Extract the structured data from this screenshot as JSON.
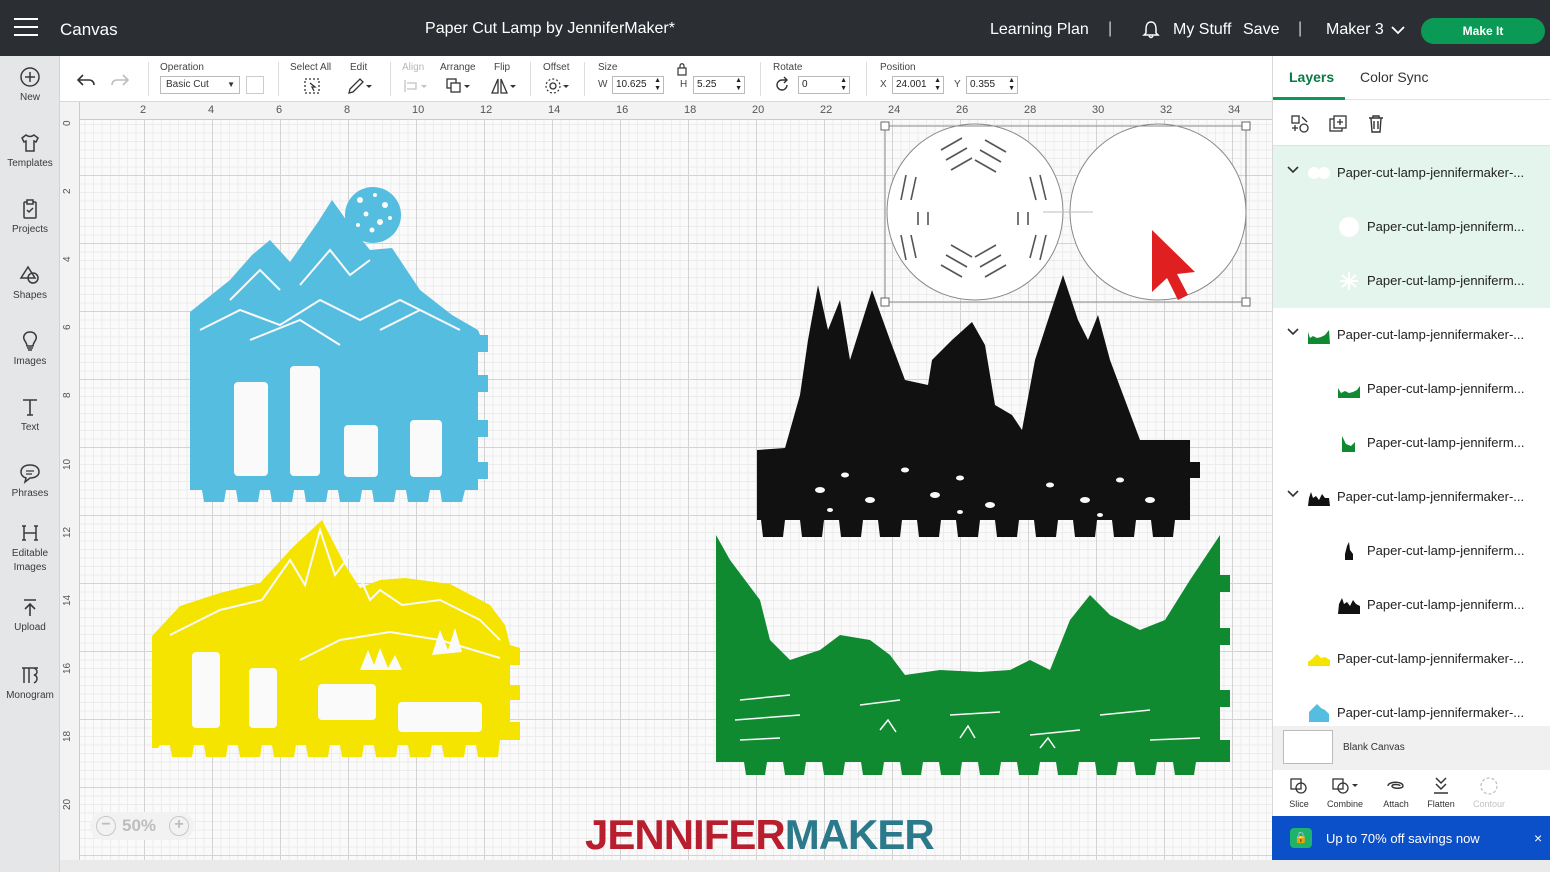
{
  "topbar": {
    "app_name": "Canvas",
    "project_title": "Paper Cut Lamp by JenniferMaker*",
    "learning_plan": "Learning Plan",
    "separator": "|",
    "my_stuff": "My Stuff",
    "save": "Save",
    "machine": "Maker 3",
    "make_it": "Make It"
  },
  "leftnav": {
    "items": [
      {
        "label": "New",
        "icon": "plus-circle-icon"
      },
      {
        "label": "Templates",
        "icon": "shirt-icon"
      },
      {
        "label": "Projects",
        "icon": "clipboard-icon"
      },
      {
        "label": "Shapes",
        "icon": "shapes-icon"
      },
      {
        "label": "Images",
        "icon": "lightbulb-icon"
      },
      {
        "label": "Text",
        "icon": "text-t-icon"
      },
      {
        "label": "Phrases",
        "icon": "speech-bubble-icon"
      },
      {
        "label": "Editable Images",
        "icon": "editable-image-icon"
      },
      {
        "label": "Upload",
        "icon": "upload-arrow-icon"
      },
      {
        "label": "Monogram",
        "icon": "monogram-icon"
      }
    ]
  },
  "toolbar": {
    "operation_label": "Operation",
    "operation_value": "Basic Cut",
    "select_all_label": "Select All",
    "edit_label": "Edit",
    "align_label": "Align",
    "arrange_label": "Arrange",
    "flip_label": "Flip",
    "offset_label": "Offset",
    "size_label": "Size",
    "w_prefix": "W",
    "w_value": "10.625",
    "h_prefix": "H",
    "h_value": "5.25",
    "rotate_label": "Rotate",
    "rotate_value": "0",
    "position_label": "Position",
    "x_prefix": "X",
    "x_value": "24.001",
    "y_prefix": "Y",
    "y_value": "0.355"
  },
  "rulers": {
    "top": [
      "2",
      "4",
      "6",
      "8",
      "10",
      "12",
      "14",
      "16",
      "18",
      "20",
      "22",
      "24",
      "26",
      "28",
      "30",
      "32",
      "34"
    ],
    "left": [
      "0",
      "2",
      "4",
      "6",
      "8",
      "10",
      "12",
      "14",
      "16",
      "18",
      "20"
    ]
  },
  "canvas": {
    "zoom": "50%",
    "brand_part1": "JENNIFER",
    "brand_part2": "MAKER"
  },
  "colors": {
    "blue_piece": "#55bde0",
    "yellow_piece": "#f5e400",
    "black_piece": "#111111",
    "green_piece": "#0f8a30",
    "accent": "#0b9a55"
  },
  "panel": {
    "tab_layers": "Layers",
    "tab_color_sync": "Color Sync",
    "layers": [
      {
        "name": "Paper-cut-lamp-jennifermaker-...",
        "level": 0,
        "expanded": true,
        "thumb": "white"
      },
      {
        "name": "Paper-cut-lamp-jenniferm...",
        "level": 1,
        "thumb": "white"
      },
      {
        "name": "Paper-cut-lamp-jenniferm...",
        "level": 1,
        "thumb": "white"
      },
      {
        "name": "Paper-cut-lamp-jennifermaker-...",
        "level": 0,
        "expanded": true,
        "thumb": "green"
      },
      {
        "name": "Paper-cut-lamp-jenniferm...",
        "level": 1,
        "thumb": "green"
      },
      {
        "name": "Paper-cut-lamp-jenniferm...",
        "level": 1,
        "thumb": "green"
      },
      {
        "name": "Paper-cut-lamp-jennifermaker-...",
        "level": 0,
        "expanded": true,
        "thumb": "black"
      },
      {
        "name": "Paper-cut-lamp-jenniferm...",
        "level": 1,
        "thumb": "black"
      },
      {
        "name": "Paper-cut-lamp-jenniferm...",
        "level": 1,
        "thumb": "black"
      },
      {
        "name": "Paper-cut-lamp-jennifermaker-...",
        "level": 0,
        "thumb": "yellow"
      },
      {
        "name": "Paper-cut-lamp-jennifermaker-...",
        "level": 0,
        "thumb": "blue"
      }
    ],
    "blank_canvas": "Blank Canvas",
    "actions": [
      {
        "label": "Slice",
        "disabled": false
      },
      {
        "label": "Combine",
        "disabled": false
      },
      {
        "label": "Attach",
        "disabled": false
      },
      {
        "label": "Flatten",
        "disabled": false
      },
      {
        "label": "Contour",
        "disabled": true
      }
    ],
    "promo": "Up to 70% off savings now",
    "promo_close": "×"
  }
}
